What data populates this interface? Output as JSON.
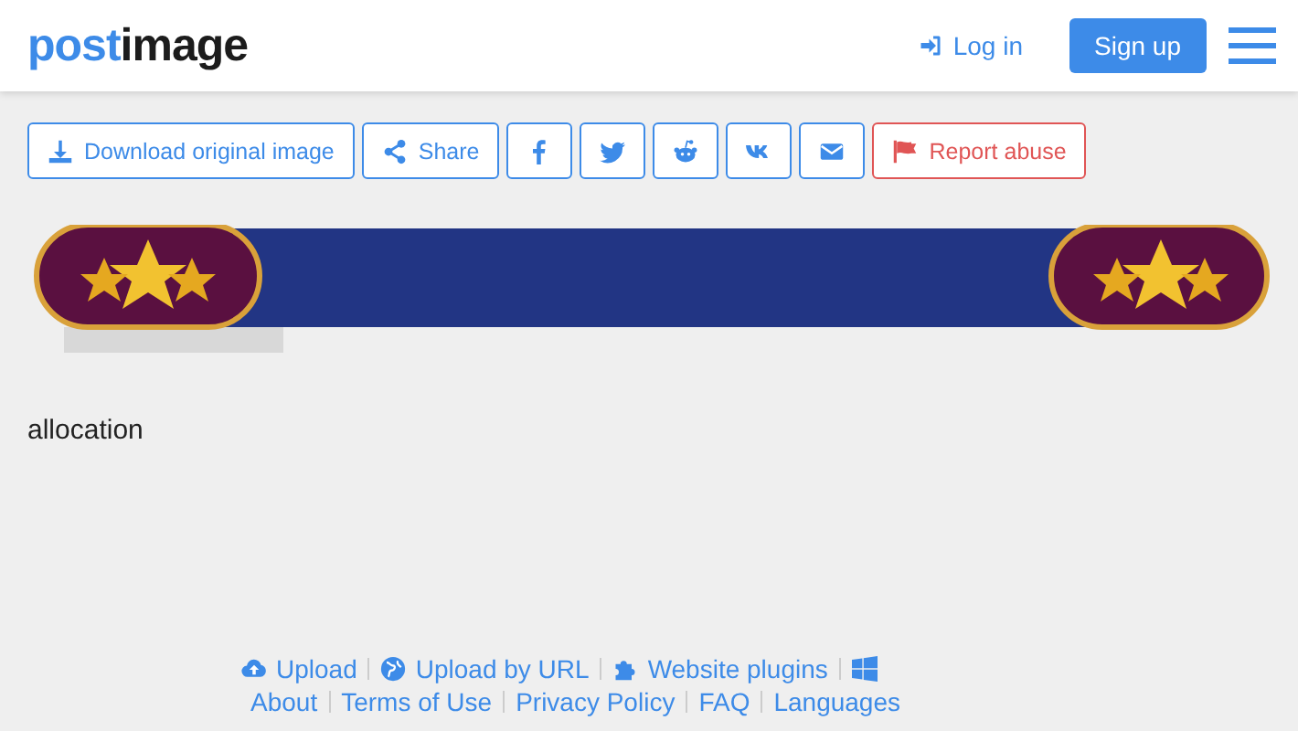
{
  "header": {
    "logo": {
      "part_1": "post",
      "part_2": "image"
    },
    "login": "Log in",
    "signup": "Sign up"
  },
  "actions": [
    {
      "kind": "download",
      "label": "Download original image"
    },
    {
      "kind": "share",
      "label": "Share"
    },
    {
      "kind": "facebook"
    },
    {
      "kind": "twitter"
    },
    {
      "kind": "reddit"
    },
    {
      "kind": "vk"
    },
    {
      "kind": "email"
    },
    {
      "kind": "report",
      "label": "Report abuse"
    }
  ],
  "caption": "allocation",
  "footer": {
    "row_1": [
      {
        "kind": "upload",
        "label": "Upload"
      },
      {
        "kind": "url",
        "label": "Upload by URL"
      },
      {
        "kind": "plugin",
        "label": "Website plugins"
      },
      {
        "kind": "windows"
      }
    ],
    "row_2": [
      "About",
      "Terms of Use",
      "Privacy Policy",
      "FAQ",
      "Languages"
    ]
  }
}
